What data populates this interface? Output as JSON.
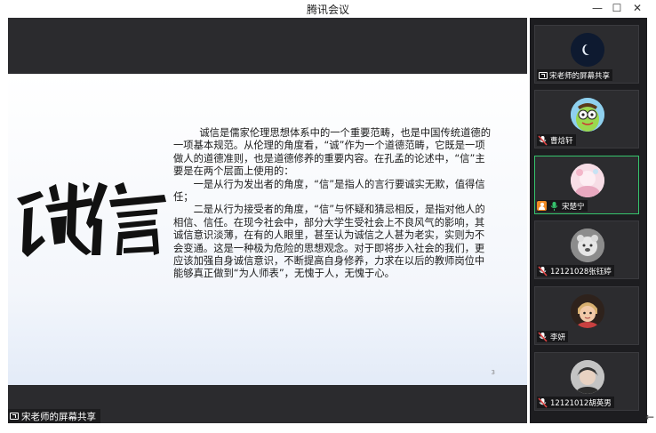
{
  "window": {
    "title": "腾讯会议",
    "minimize_glyph": "—",
    "maximize_glyph": "☐",
    "close_glyph": "✕"
  },
  "slide": {
    "calligraphy": "诚信",
    "paragraphs": [
      "诚信是儒家伦理思想体系中的一个重要范畴，也是中国传统道德的一项基本规范。从伦理的角度看，“诚”作为一个道德范畴，它既是一项做人的道德准则，也是道德修养的重要内容。在孔孟的论述中，“信”主要是在两个层面上使用的：",
      "一是从行为发出者的角度，“信”是指人的言行要诚实无欺，值得信任；",
      "二是从行为接受者的角度，“信”与怀疑和猜忌相反，是指对他人的相信、信任。在现今社会中，部分大学生受社会上不良风气的影响，其诚信意识淡薄，在有的人眼里，甚至认为诚信之人甚为老实，实则为不会变通。这是一种极为危险的思想观念。对于即将步入社会的我们，更应该加强自身诚信意识，不断提高自身修养，力求在以后的教师岗位中能够真正做到“为人师表”，无愧于人，无愧于心。"
    ],
    "page_number": "3"
  },
  "share_badge": "宋老师的屏幕共享",
  "participants": [
    {
      "name": "宋老师的屏幕共享",
      "type": "screen-share",
      "avatar": "moon"
    },
    {
      "name": "曹焓轩",
      "type": "muted",
      "avatar": "cartoon"
    },
    {
      "name": "宋楚宁",
      "type": "host-speaking",
      "avatar": "pink"
    },
    {
      "name": "12121028张钰婷",
      "type": "muted",
      "avatar": "bear"
    },
    {
      "name": "李妍",
      "type": "muted",
      "avatar": "kid"
    },
    {
      "name": "12121012胡英男",
      "type": "muted",
      "avatar": "portrait"
    }
  ],
  "colors": {
    "active_speaker_border": "#36c46d",
    "host_badge": "#f08a24",
    "mic_muted": "#e04444",
    "mic_active": "#36c46d"
  }
}
